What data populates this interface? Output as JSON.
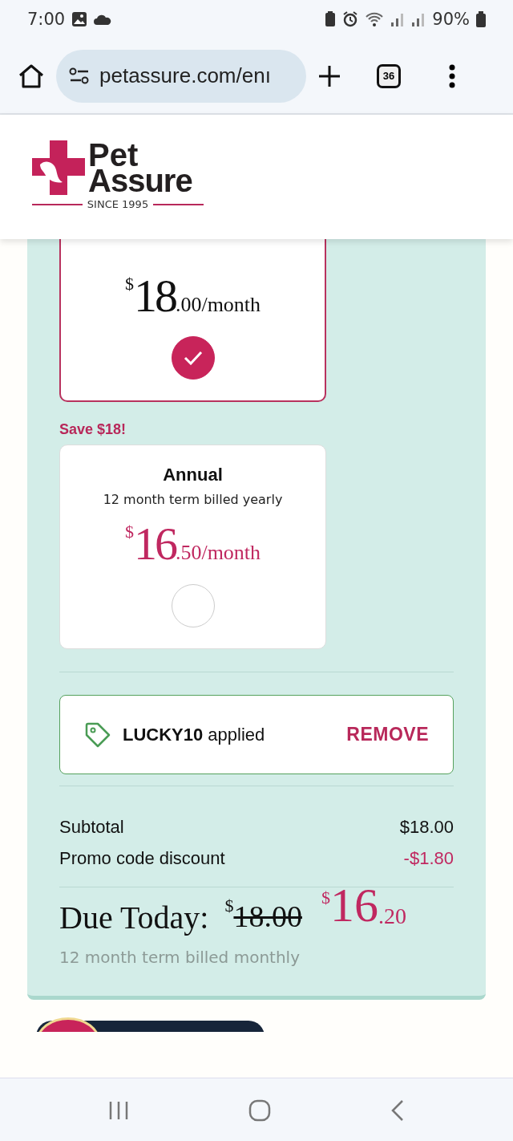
{
  "status_bar": {
    "time": "7:00",
    "battery": "90%"
  },
  "browser": {
    "url": "petassure.com/enı",
    "tab_count": "36"
  },
  "logo": {
    "line1": "Pet",
    "line2": "Assure",
    "tagline": "SINCE 1995"
  },
  "plans": [
    {
      "currency": "$",
      "whole": "18",
      "fraction": ".00/month",
      "selected": true
    },
    {
      "badge": "Save $18!",
      "title": "Annual",
      "term": "12 month term billed yearly",
      "currency": "$",
      "whole": "16",
      "fraction": ".50/month",
      "selected": false
    }
  ],
  "promo": {
    "code": "LUCKY10",
    "status": "applied",
    "action": "REMOVE"
  },
  "summary": [
    {
      "label": "Subtotal",
      "value": "$18.00",
      "kind": "plain"
    },
    {
      "label": "Promo code discount",
      "value": "-$1.80",
      "kind": "discount"
    }
  ],
  "due": {
    "label": "Due Today:",
    "old_currency": "$",
    "old_amount": "18.00",
    "currency": "$",
    "whole": "16",
    "fraction": ".20",
    "note": "12 month term billed monthly"
  }
}
